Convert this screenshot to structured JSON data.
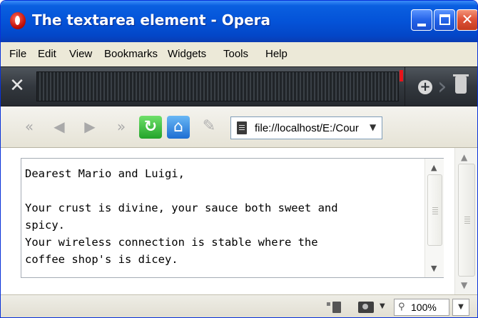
{
  "window": {
    "title": "The textarea element - Opera"
  },
  "menu": {
    "items": [
      "File",
      "Edit",
      "View",
      "Bookmarks",
      "Widgets",
      "Tools",
      "Help"
    ]
  },
  "address_bar": {
    "value": "file://localhost/E:/Cour"
  },
  "textarea": {
    "value": "Dearest Mario and Luigi,\n\nYour crust is divine, your sauce both sweet and\nspicy.\nYour wireless connection is stable where the\ncoffee shop's is dicey."
  },
  "status": {
    "zoom": "100%"
  },
  "icons": {
    "title": "opera-icon",
    "panel": [
      "tools-icon",
      "add-panel-icon",
      "trash-icon"
    ],
    "nav": [
      "rewind-icon",
      "back-icon",
      "forward-icon",
      "fast-forward-icon",
      "reload-icon",
      "home-icon",
      "edit-icon"
    ],
    "status": [
      "document-icon",
      "image-icon",
      "zoom-icon"
    ]
  },
  "colors": {
    "titlebar": "#0453d8",
    "close_button": "#e0543a",
    "reload_button": "#23a32a",
    "home_button": "#1d6ed2",
    "panel_marker": "#e8141a"
  }
}
